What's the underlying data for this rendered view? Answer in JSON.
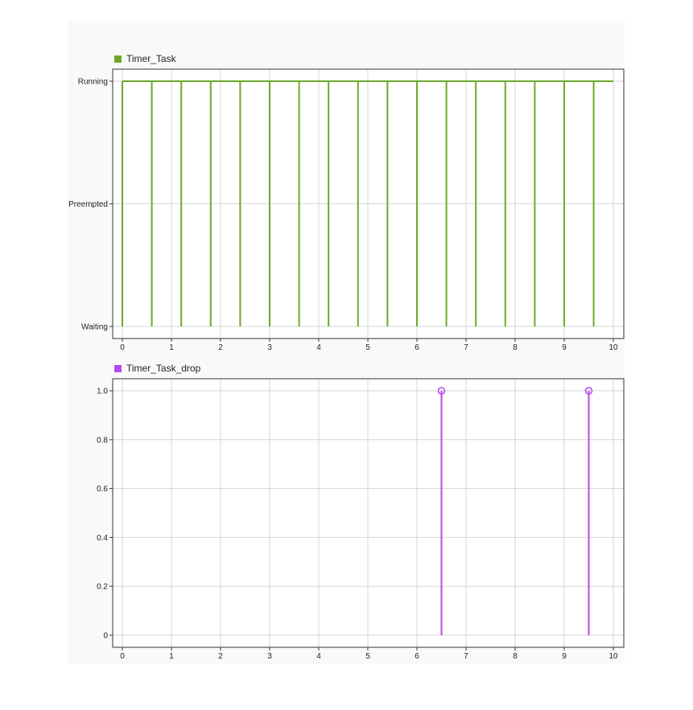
{
  "colors": {
    "task": "#6fa82b",
    "drop": "#b54ae8",
    "grid": "#d6d6d6",
    "axis": "#333333"
  },
  "chart_data": [
    {
      "type": "line",
      "legend": "Timer_Task",
      "xlim": [
        0,
        10
      ],
      "xticks": [
        "0",
        "1",
        "2",
        "3",
        "4",
        "5",
        "6",
        "7",
        "8",
        "9",
        "10"
      ],
      "yticks": [
        "Waiting",
        "Preempted",
        "Running"
      ],
      "ylim": [
        0,
        2
      ],
      "grid": true,
      "series": [
        {
          "name": "Timer_Task",
          "spikes_x": [
            0,
            0.6,
            1.2,
            1.8,
            2.4,
            3.0,
            3.6,
            4.2,
            4.8,
            5.4,
            6.0,
            6.6,
            7.2,
            7.8,
            8.4,
            9.0,
            9.6
          ],
          "high_level": 2,
          "low_level": 0,
          "x_end": 10
        }
      ]
    },
    {
      "type": "stem",
      "legend": "Timer_Task_drop",
      "xlim": [
        0,
        10
      ],
      "ylim": [
        0,
        1
      ],
      "xticks": [
        "0",
        "1",
        "2",
        "3",
        "4",
        "5",
        "6",
        "7",
        "8",
        "9",
        "10"
      ],
      "yticks": [
        "0",
        "0.2",
        "0.4",
        "0.6",
        "0.8",
        "1.0"
      ],
      "grid": true,
      "series": [
        {
          "name": "Timer_Task_drop",
          "x": [
            6.5,
            9.5
          ],
          "y": [
            1,
            1
          ]
        }
      ]
    }
  ]
}
